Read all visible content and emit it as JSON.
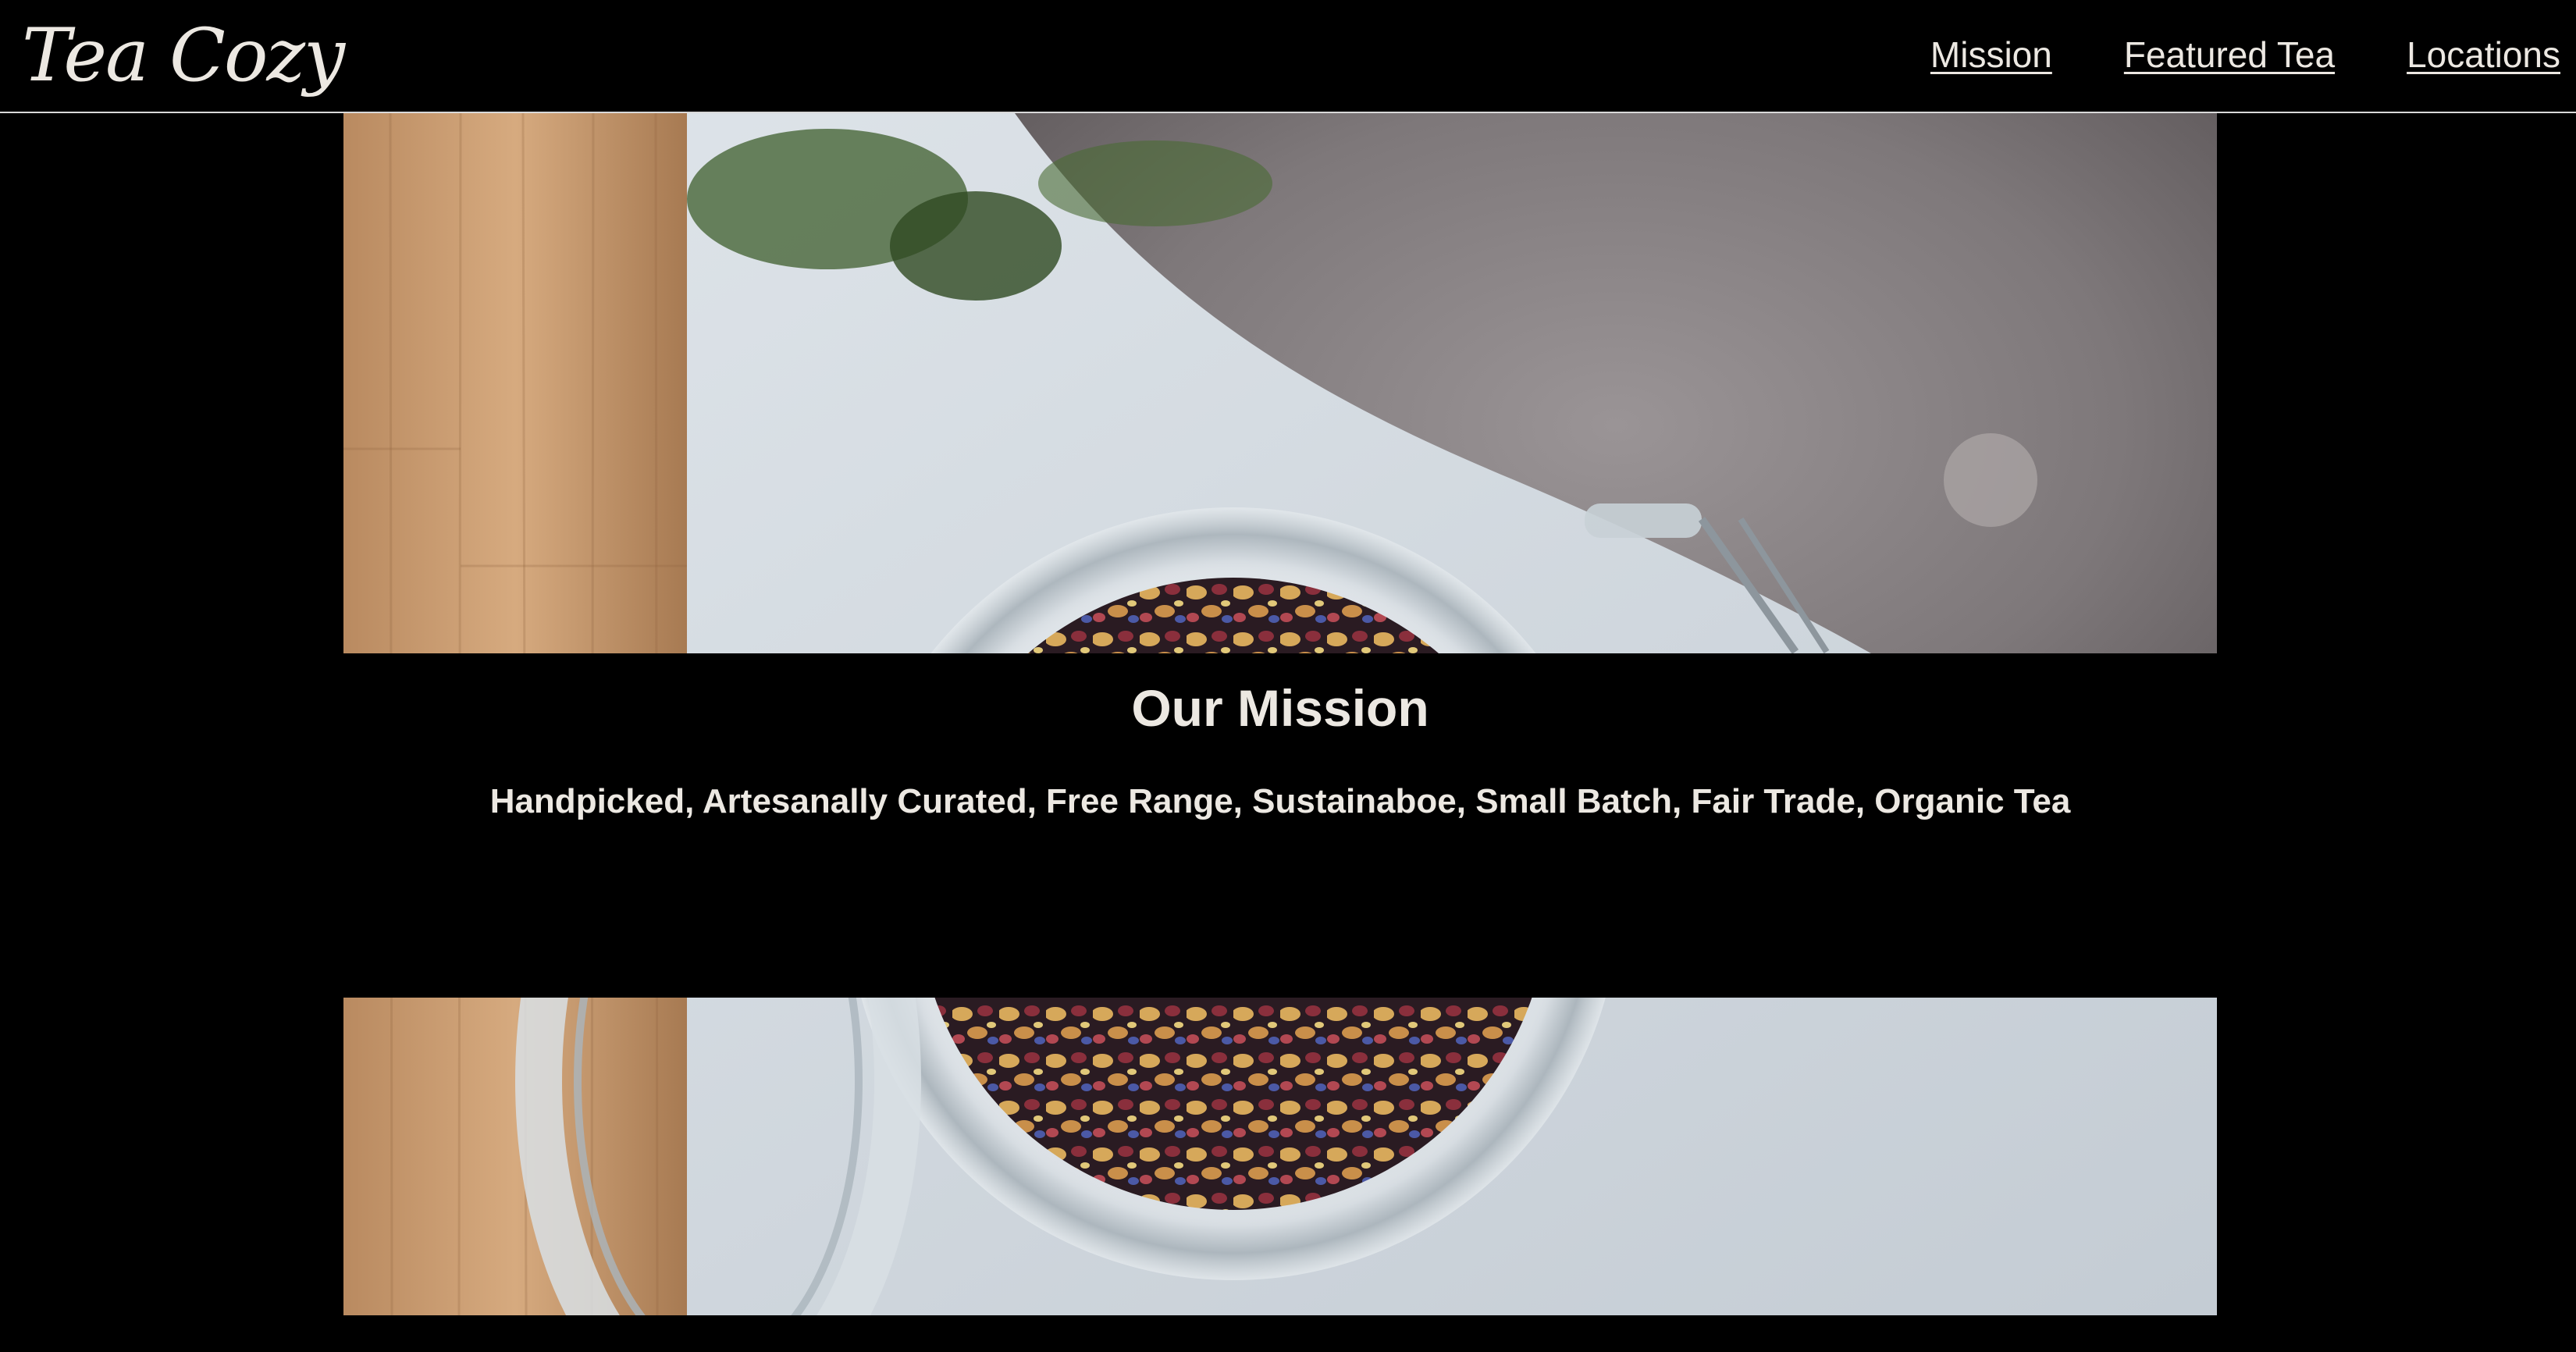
{
  "brand": {
    "logo_text": "Tea Cozy"
  },
  "nav": {
    "items": [
      {
        "label": "Mission"
      },
      {
        "label": "Featured Tea"
      },
      {
        "label": "Locations"
      }
    ]
  },
  "hero": {
    "image_description_icon": "tea-jar-photo"
  },
  "mission": {
    "title": "Our Mission",
    "text": "Handpicked, Artesanally Curated, Free Range, Sustainaboe, Small Batch, Fair Trade, Organic Tea"
  },
  "colors": {
    "background": "#000000",
    "text": "#ece8e2",
    "header_border": "#d9d9d9"
  }
}
